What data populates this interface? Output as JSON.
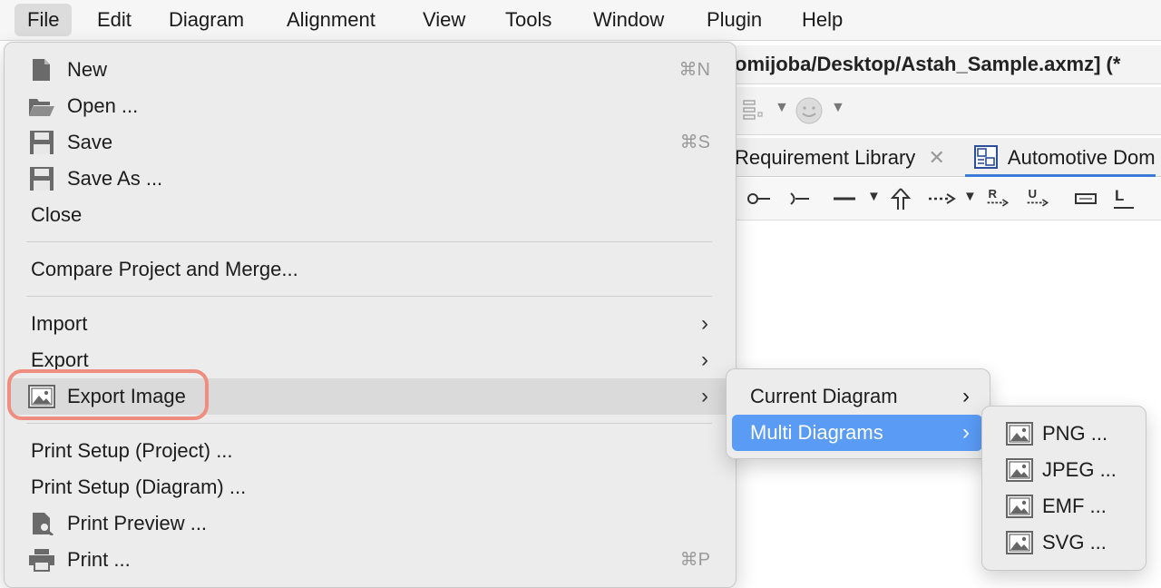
{
  "menubar": {
    "items": [
      "File",
      "Edit",
      "Diagram",
      "Alignment",
      "View",
      "Tools",
      "Window",
      "Plugin",
      "Help"
    ]
  },
  "window": {
    "title": "omijoba/Desktop/Astah_Sample.axmz] (*"
  },
  "tabs": [
    {
      "label": "Requirement Library"
    },
    {
      "label": "Automotive Dom"
    }
  ],
  "file_menu": {
    "new": {
      "label": "New",
      "shortcut": "⌘N"
    },
    "open": {
      "label": "Open ..."
    },
    "save": {
      "label": "Save",
      "shortcut": "⌘S"
    },
    "save_as": {
      "label": "Save As ..."
    },
    "close": {
      "label": "Close"
    },
    "compare": {
      "label": "Compare Project and Merge..."
    },
    "import": {
      "label": "Import"
    },
    "export": {
      "label": "Export"
    },
    "export_image": {
      "label": "Export Image"
    },
    "print_setup_project": {
      "label": "Print Setup (Project) ..."
    },
    "print_setup_diagram": {
      "label": "Print Setup (Diagram) ..."
    },
    "print_preview": {
      "label": "Print Preview ..."
    },
    "print": {
      "label": "Print ...",
      "shortcut": "⌘P"
    }
  },
  "export_image_submenu": {
    "current_diagram": {
      "label": "Current Diagram"
    },
    "multi_diagrams": {
      "label": "Multi Diagrams"
    }
  },
  "multi_diagrams_submenu": {
    "items": [
      "PNG ...",
      "JPEG ...",
      "EMF ...",
      "SVG ..."
    ]
  },
  "colors": {
    "highlight_ring": "#ef8e80",
    "selection": "#5a9bf5",
    "tab_accent": "#3d7bd9"
  }
}
